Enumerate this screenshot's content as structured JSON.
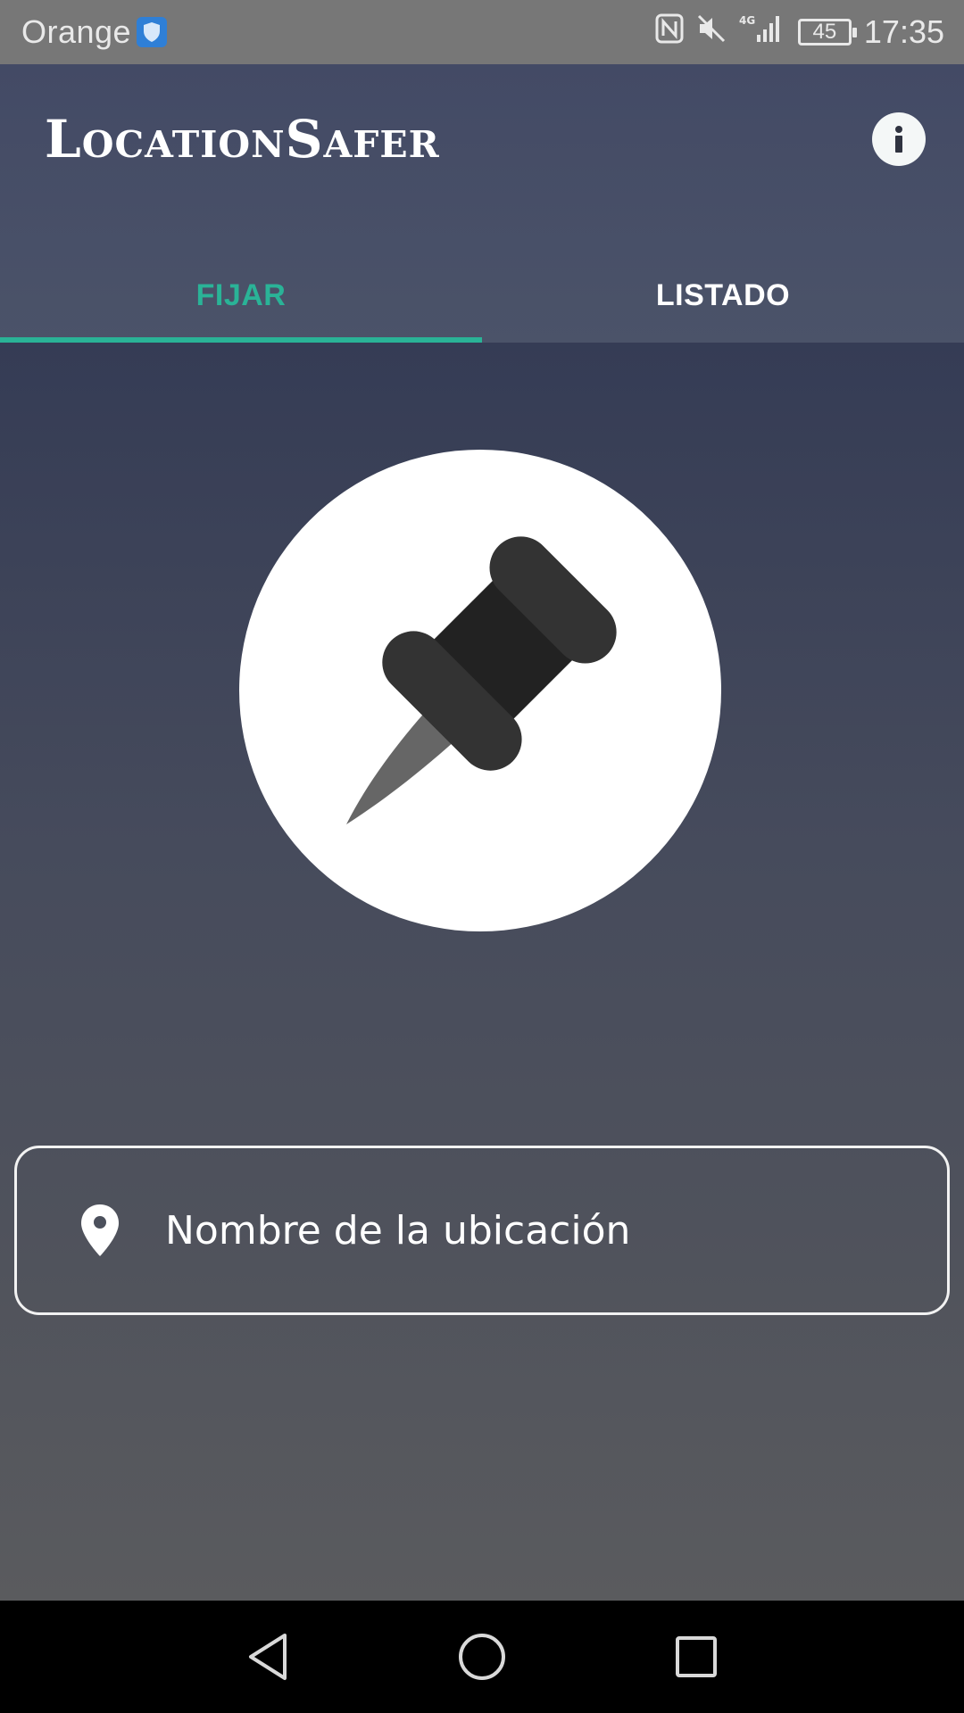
{
  "status_bar": {
    "carrier": "Orange",
    "battery_level": "45",
    "time": "17:35",
    "network": "4G",
    "icons": [
      "shield-icon",
      "nfc-icon",
      "mute-icon",
      "signal-icon",
      "battery-icon"
    ]
  },
  "app_bar": {
    "title": "LocationSafer",
    "info_icon": "info-icon"
  },
  "tabs": [
    {
      "label": "FIJAR",
      "active": true
    },
    {
      "label": "LISTADO",
      "active": false
    }
  ],
  "main": {
    "pin_icon": "pushpin-icon",
    "location_input": {
      "placeholder": "Nombre de la ubicación",
      "value": "",
      "icon": "location-pin-icon"
    }
  },
  "nav_bar": {
    "buttons": [
      "back-icon",
      "home-icon",
      "recents-icon"
    ]
  },
  "colors": {
    "accent": "#2ab397",
    "app_bar": "#474e67",
    "status_bar": "#777777"
  }
}
